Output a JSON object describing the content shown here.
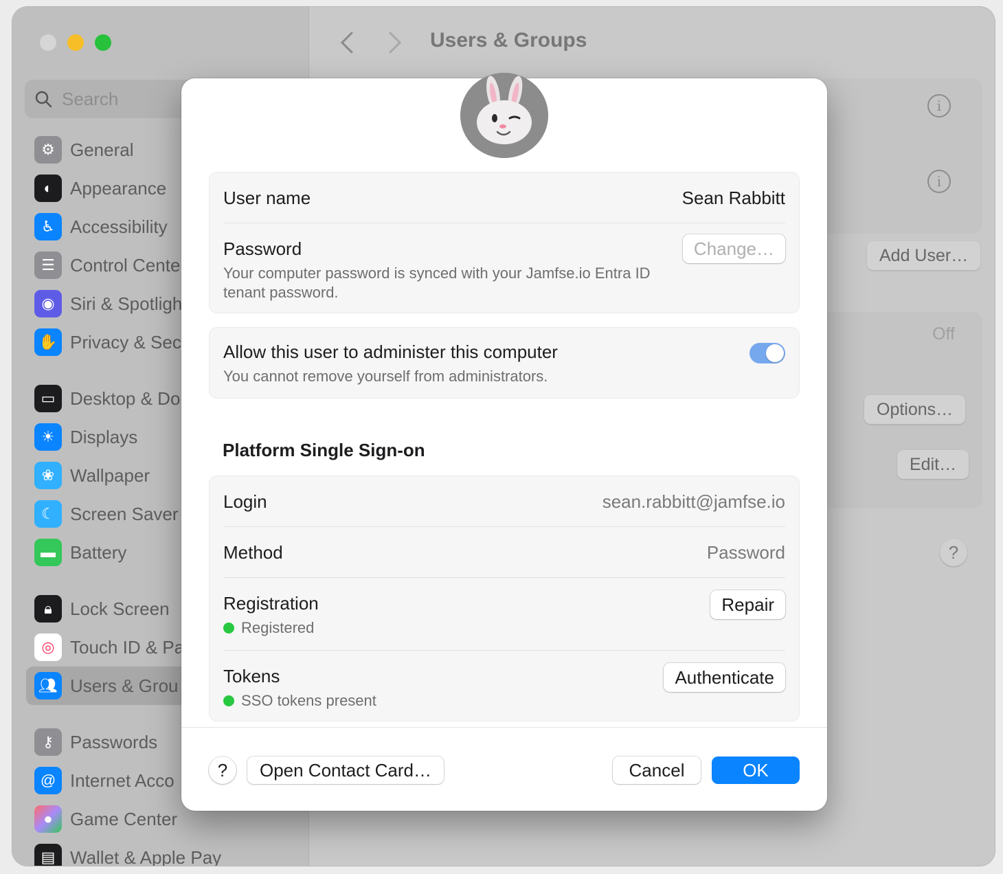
{
  "window": {
    "title": "Users & Groups",
    "search_placeholder": "Search"
  },
  "sidebar": {
    "items": [
      {
        "label": "General",
        "icon": "gear-icon",
        "color": "#8e8e93"
      },
      {
        "label": "Appearance",
        "icon": "appearance-icon",
        "color": "#1c1c1e"
      },
      {
        "label": "Accessibility",
        "icon": "accessibility-icon",
        "color": "#0a84ff"
      },
      {
        "label": "Control Cente",
        "icon": "control-center-icon",
        "color": "#8e8e93"
      },
      {
        "label": "Siri & Spotligh",
        "icon": "siri-icon",
        "color": "#5e5ce6"
      },
      {
        "label": "Privacy & Sec",
        "icon": "hand-icon",
        "color": "#0a84ff"
      },
      {
        "label": "Desktop & Do",
        "icon": "desktop-icon",
        "color": "#1c1c1e"
      },
      {
        "label": "Displays",
        "icon": "sun-icon",
        "color": "#0a84ff"
      },
      {
        "label": "Wallpaper",
        "icon": "flower-icon",
        "color": "#30b0ff"
      },
      {
        "label": "Screen Saver",
        "icon": "screen-saver-icon",
        "color": "#30b0ff"
      },
      {
        "label": "Battery",
        "icon": "battery-icon",
        "color": "#34c759"
      },
      {
        "label": "Lock Screen",
        "icon": "lock-icon",
        "color": "#1c1c1e"
      },
      {
        "label": "Touch ID & Pa",
        "icon": "fingerprint-icon",
        "color": "#ffffff"
      },
      {
        "label": "Users & Grou",
        "icon": "users-icon",
        "color": "#0a84ff"
      },
      {
        "label": "Passwords",
        "icon": "key-icon",
        "color": "#8e8e93"
      },
      {
        "label": "Internet Acco",
        "icon": "at-icon",
        "color": "#0a84ff"
      },
      {
        "label": "Game Center",
        "icon": "game-center-icon",
        "color": "#ff6b6b"
      },
      {
        "label": "Wallet & Apple Pay",
        "icon": "wallet-icon",
        "color": "#1c1c1e"
      }
    ]
  },
  "background": {
    "add_user_label": "Add User…",
    "off_label": "Off",
    "options_label": "Options…",
    "edit_label": "Edit…",
    "help_label": "?"
  },
  "dialog": {
    "account": {
      "username_label": "User name",
      "username_value": "Sean Rabbitt",
      "password_label": "Password",
      "password_desc": "Your computer password is synced with your Jamfse.io Entra ID tenant password.",
      "change_label": "Change…"
    },
    "admin": {
      "label": "Allow this user to administer this computer",
      "desc": "You cannot remove yourself from administrators.",
      "enabled": true
    },
    "psso": {
      "section_title": "Platform Single Sign-on",
      "login_label": "Login",
      "login_value": "sean.rabbitt@jamfse.io",
      "method_label": "Method",
      "method_value": "Password",
      "registration_label": "Registration",
      "registration_status": "Registered",
      "repair_label": "Repair",
      "tokens_label": "Tokens",
      "tokens_status": "SSO tokens present",
      "authenticate_label": "Authenticate",
      "status_color": "#28c840"
    },
    "footer": {
      "help_label": "?",
      "contact_label": "Open Contact Card…",
      "cancel_label": "Cancel",
      "ok_label": "OK"
    }
  }
}
